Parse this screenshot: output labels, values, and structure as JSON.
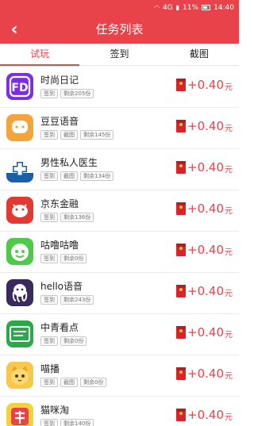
{
  "status": {
    "signal": "4G",
    "battery_pct": "11%",
    "time": "14:40"
  },
  "header": {
    "title": "任务列表"
  },
  "tabs": [
    {
      "label": "试玩",
      "active": true
    },
    {
      "label": "签到",
      "active": false
    },
    {
      "label": "截图",
      "active": false
    }
  ],
  "tasks": [
    {
      "name": "时尚日记",
      "icon": "fashion-diary-icon",
      "tags": [
        "签到",
        "剩余205份"
      ],
      "amount": "+0.40",
      "unit": "元"
    },
    {
      "name": "豆豆语音",
      "icon": "doudou-voice-icon",
      "tags": [
        "签到",
        "截图",
        "剩余145份"
      ],
      "amount": "+0.40",
      "unit": "元"
    },
    {
      "name": "男性私人医生",
      "icon": "male-doctor-icon",
      "tags": [
        "签到",
        "截图",
        "剩余134份"
      ],
      "amount": "+0.40",
      "unit": "元"
    },
    {
      "name": "京东金融",
      "icon": "jd-finance-icon",
      "tags": [
        "签到",
        "剩余136份"
      ],
      "amount": "+0.40",
      "unit": "元"
    },
    {
      "name": "咕噜咕噜",
      "icon": "gulu-icon",
      "tags": [
        "签到",
        "剩余0份"
      ],
      "amount": "+0.40",
      "unit": "元"
    },
    {
      "name": "hello语音",
      "icon": "hello-voice-icon",
      "tags": [
        "签到",
        "剩余243份"
      ],
      "amount": "+0.40",
      "unit": "元"
    },
    {
      "name": "中青看点",
      "icon": "zhongqing-icon",
      "tags": [
        "签到",
        "剩余0份"
      ],
      "amount": "+0.40",
      "unit": "元"
    },
    {
      "name": "喵播",
      "icon": "miaobo-icon",
      "tags": [
        "签到",
        "截图",
        "剩余0份"
      ],
      "amount": "+0.40",
      "unit": "元"
    },
    {
      "name": "猫咪淘",
      "icon": "maomitao-icon",
      "tags": [
        "签到",
        "剩余140份"
      ],
      "amount": "+0.40",
      "unit": "元"
    }
  ],
  "colors": {
    "accent": "#e8434a",
    "envelope": "#d8232a"
  }
}
